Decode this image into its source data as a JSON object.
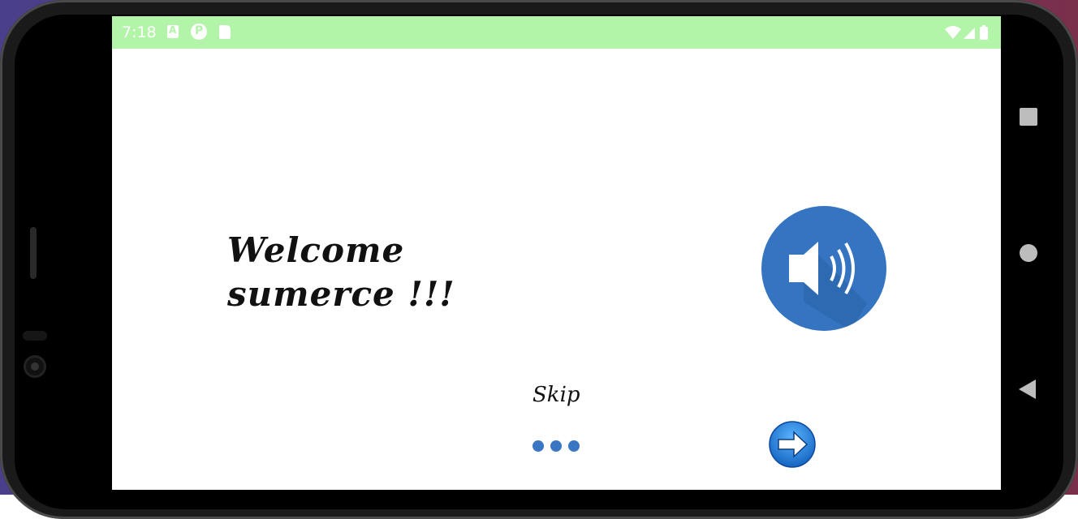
{
  "status_bar": {
    "time": "7:18",
    "background_color": "#b3f5a8",
    "icons_left": [
      "notification-a-icon",
      "notification-p-icon",
      "sd-card-icon"
    ],
    "icons_right": [
      "wifi-icon",
      "cell-signal-icon",
      "battery-icon"
    ]
  },
  "main": {
    "welcome_text": "Welcome\nsumerce !!!",
    "speaker_button": "speaker-volume-icon",
    "speaker_color": "#3474c0",
    "skip_label": "Skip",
    "page_indicator_count": 3,
    "next_button": "arrow-right-icon",
    "accent_color": "#3a76c2"
  },
  "nav_bar": {
    "items": [
      "overview-square-icon",
      "home-circle-icon",
      "back-triangle-icon"
    ]
  }
}
